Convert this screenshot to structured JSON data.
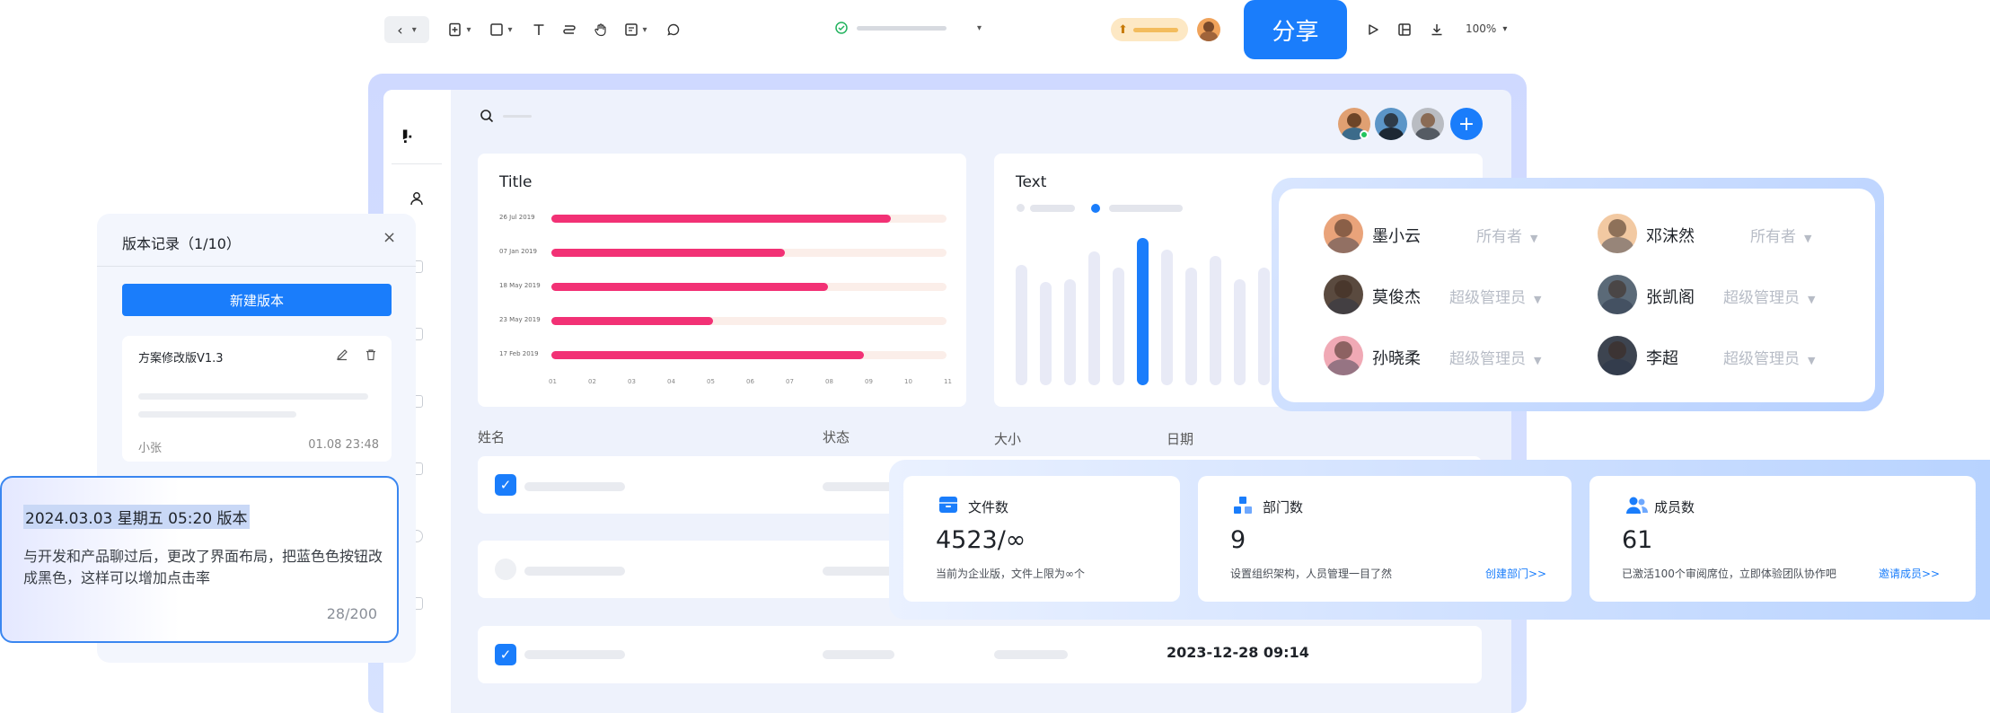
{
  "toolbar": {
    "title_placeholder": "",
    "share_label": "分享",
    "zoom": "100%"
  },
  "workspace": {
    "bar_chart": {
      "title": "Title"
    },
    "column_chart": {
      "title": "Text"
    },
    "table": {
      "columns": [
        "姓名",
        "状态",
        "大小",
        "日期"
      ],
      "rows": [
        {
          "checked": true,
          "date": ""
        },
        {
          "checked": false,
          "date": ""
        },
        {
          "checked": true,
          "date": "2023-12-28 09:14"
        }
      ]
    }
  },
  "chart_data": [
    {
      "type": "bar",
      "title": "Title",
      "categories": [
        "26 Jul 2019",
        "07 Jan 2019",
        "18 May 2019",
        "23 May 2019",
        "17 Feb 2019"
      ],
      "values": [
        8.6,
        5.9,
        7.0,
        4.1,
        7.9
      ],
      "xticks": [
        "01",
        "02",
        "03",
        "04",
        "05",
        "06",
        "07",
        "08",
        "09",
        "10",
        "11"
      ],
      "xlim": [
        0,
        10
      ],
      "colors": {
        "fill": "#f23175",
        "track": "#fbeee9"
      }
    },
    {
      "type": "bar",
      "title": "Text",
      "values": [
        8.2,
        7.0,
        7.2,
        9.1,
        8.0,
        10.0,
        9.2,
        8.0,
        8.8,
        7.2,
        8.0
      ],
      "highlight_index": 5,
      "colors": {
        "highlight": "#1a7dfb",
        "base": "#e8eaf6"
      }
    }
  ],
  "roles": {
    "members": [
      {
        "name": "墨小云",
        "role": "所有者",
        "avatar_color": "#e9a37a"
      },
      {
        "name": "邓沫然",
        "role": "所有者",
        "avatar_color": "#f2c9a2"
      },
      {
        "name": "莫俊杰",
        "role": "超级管理员",
        "avatar_color": "#5a4a3f"
      },
      {
        "name": "张凯阁",
        "role": "超级管理员",
        "avatar_color": "#5b6a78"
      },
      {
        "name": "孙晓柔",
        "role": "超级管理员",
        "avatar_color": "#f0a9b5"
      },
      {
        "name": "李超",
        "role": "超级管理员",
        "avatar_color": "#3d4450"
      }
    ]
  },
  "stats": [
    {
      "title": "文件数",
      "value": "4523/∞",
      "desc": "当前为企业版，文件上限为∞个",
      "link": ""
    },
    {
      "title": "部门数",
      "value": "9",
      "desc": "设置组织架构，人员管理一目了然",
      "link": "创建部门>>"
    },
    {
      "title": "成员数",
      "value": "61",
      "desc": "已激活100个审阅席位，立即体验团队协作吧",
      "link": "邀请成员>>"
    }
  ],
  "versions": {
    "header": "版本记录（1/10）",
    "new_button": "新建版本",
    "item": {
      "title": "方案修改版V1.3",
      "author": "小张",
      "time": "01.08 23:48"
    },
    "note": {
      "heading": "2024.03.03 星期五 05:20 版本",
      "body": "与开发和产品聊过后，更改了界面布局，把蓝色色按钮改成黑色，这样可以增加点击率",
      "counter": "28/200"
    }
  },
  "colors": {
    "accent": "#1a7dfb",
    "bar": "#f23175"
  }
}
